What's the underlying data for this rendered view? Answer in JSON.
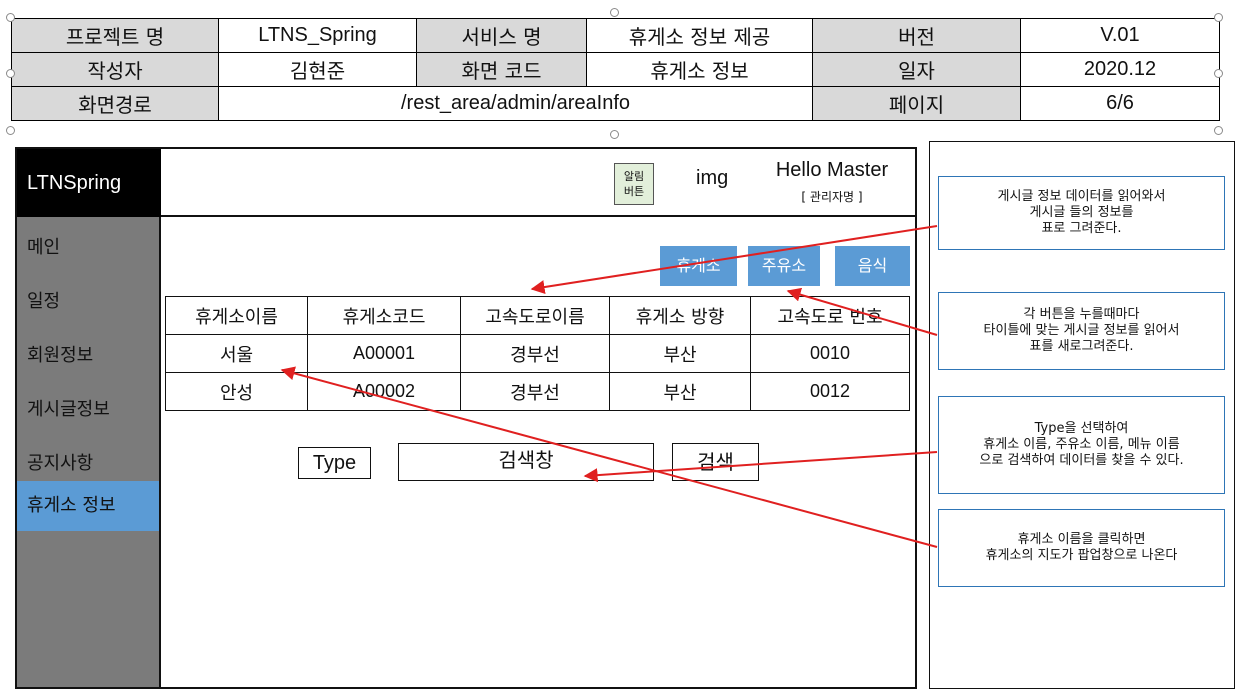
{
  "spec": {
    "project_label": "프로젝트 명",
    "project_value": "LTNS_Spring",
    "service_label": "서비스 명",
    "service_value": "휴게소 정보 제공",
    "version_label": "버전",
    "version_value": "V.01",
    "author_label": "작성자",
    "author_value": "김현준",
    "screen_code_label": "화면 코드",
    "screen_code_value": "휴게소 정보",
    "date_label": "일자",
    "date_value": "2020.12",
    "path_label": "화면경로",
    "path_value": "/rest_area/admin/areaInfo",
    "page_label": "페이지",
    "page_value": "6/6"
  },
  "app": {
    "brand": "LTNSpring",
    "alarm_line1": "알림",
    "alarm_line2": "버튼",
    "img_label": "img",
    "greeting": "Hello Master",
    "role": "[ 관리자명 ]"
  },
  "sidebar": {
    "items": [
      {
        "label": "메인"
      },
      {
        "label": "일정"
      },
      {
        "label": "회원정보"
      },
      {
        "label": "게시글정보"
      },
      {
        "label": "공지사항"
      },
      {
        "label": "휴게소 정보"
      }
    ]
  },
  "filters": {
    "rest_area": "휴게소",
    "gas_station": "주유소",
    "food": "음식"
  },
  "table": {
    "headers": [
      "휴게소이름",
      "휴게소코드",
      "고속도로이름",
      "휴게소 방향",
      "고속도로 번호"
    ],
    "rows": [
      [
        "서울",
        "A00001",
        "경부선",
        "부산",
        "0010"
      ],
      [
        "안성",
        "A00002",
        "경부선",
        "부산",
        "0012"
      ]
    ]
  },
  "search": {
    "type_label": "Type",
    "input_label": "검색창",
    "button_label": "검색"
  },
  "notes": [
    "게시글 정보 데이터를 읽어와서\n게시글 들의 정보를\n표로 그려준다.",
    "각 버튼을 누를때마다\n타이틀에 맞는 게시글 정보를 읽어서\n표를 새로그려준다.",
    "Type을 선택하여\n휴게소 이름, 주유소 이름, 메뉴 이름\n으로 검색하여 데이터를 찾을 수 있다.",
    "휴게소 이름을 클릭하면\n휴게소의 지도가 팝업창으로 나온다"
  ],
  "colors": {
    "header_cell": "#d9d9d9",
    "brand_bg": "#000000",
    "sidebar_bg": "#7b7b7b",
    "accent": "#5b9bd5",
    "alarm_bg": "#e2efda",
    "note_border": "#2e75b6",
    "arrow": "#e02020"
  },
  "icons": [
    "selection-handle-icon",
    "arrow-icon"
  ]
}
